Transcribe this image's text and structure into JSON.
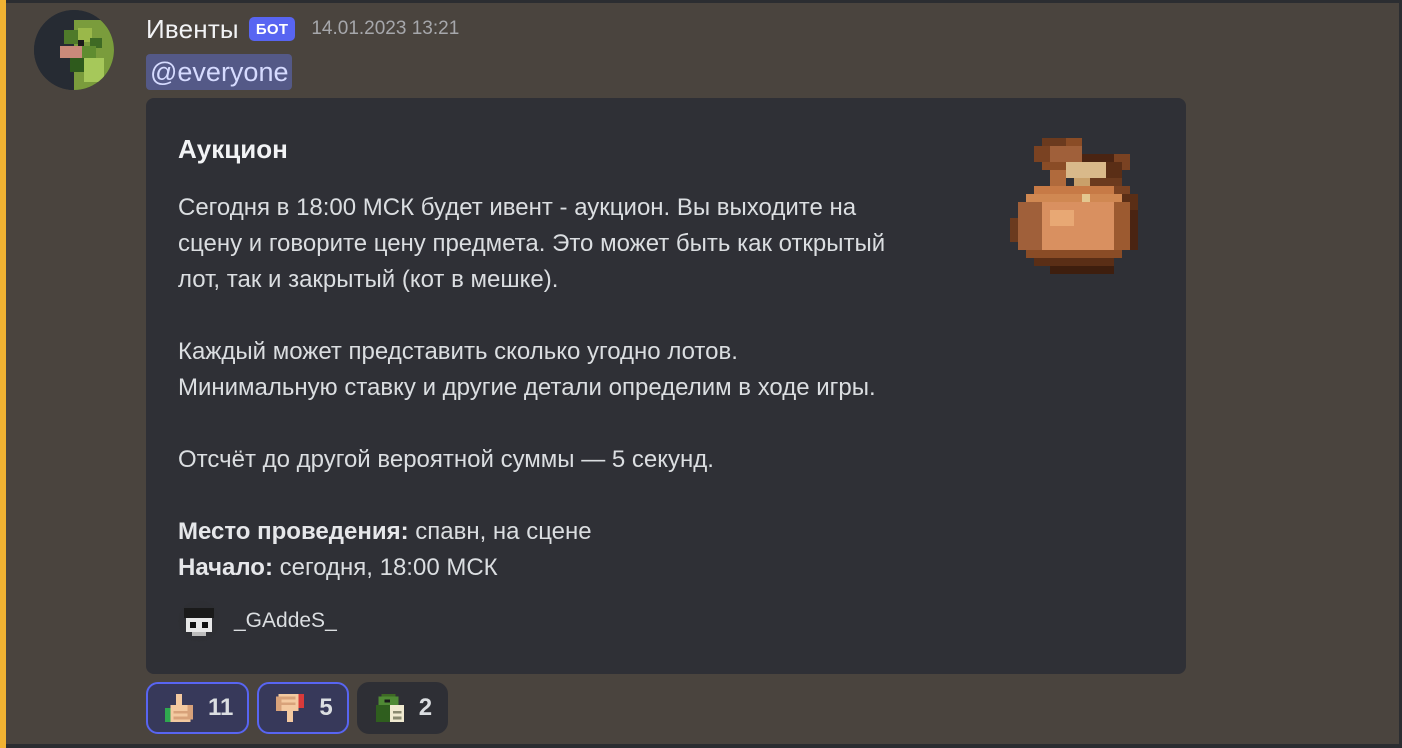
{
  "message": {
    "author": "Ивенты",
    "bot_tag": "БОТ",
    "timestamp": "14.01.2023 13:21",
    "mention": "@everyone"
  },
  "embed": {
    "title": "Аукцион",
    "paragraph1": [
      "Сегодня в 18:00 МСК будет ивент - аукцион. Вы выходите на",
      "сцену и говорите цену предмета. Это может быть как открытый",
      "лот, так и закрытый (кот в мешке)."
    ],
    "paragraph2": [
      "Каждый может представить сколько угодно лотов.",
      "Минимальную ставку и другие детали определим в ходе игры."
    ],
    "paragraph3": "Отсчёт до другой вероятной суммы — 5 секунд.",
    "fields": [
      {
        "label": "Место проведения:",
        "value": " спавн, на сцене"
      },
      {
        "label": "Начало:",
        "value": " сегодня, 18:00 МСК"
      }
    ],
    "footer": "_GAddeS_",
    "thumbnail_icon": "bag-icon"
  },
  "reactions": [
    {
      "emoji": "thumbs-up-icon",
      "count": "11",
      "selected": true
    },
    {
      "emoji": "thumbs-down-icon",
      "count": "5",
      "selected": true
    },
    {
      "emoji": "pepe-icon",
      "count": "2",
      "selected": false
    }
  ],
  "colors": {
    "mention_bar": "#f0b232",
    "bot_tag": "#5865f2",
    "embed_bg": "#2f3036",
    "mention_bg": "#545987"
  }
}
